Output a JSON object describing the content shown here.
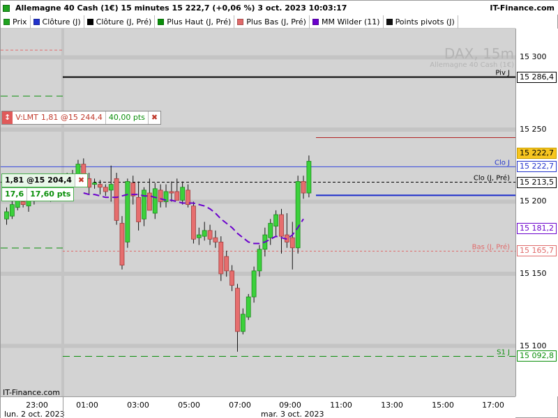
{
  "header": {
    "title": "Allemagne 40 Cash (1€) 15 minutes 15 222,7 (+0,06 %) 3 oct. 2023 10:03:17",
    "brand": "IT-Finance.com",
    "title_color": "#1fa31f"
  },
  "legend": [
    {
      "label": "Prix",
      "color": "#1fa31f"
    },
    {
      "label": "Clôture (J)",
      "color": "#2233cc"
    },
    {
      "label": "Clôture (J, Pré)",
      "color": "#000000"
    },
    {
      "label": "Plus Haut (J, Pré)",
      "color": "#0a8f0a"
    },
    {
      "label": "Plus Bas (J, Pré)",
      "color": "#e06a6a"
    },
    {
      "label": "MM Wilder (11)",
      "color": "#6a00cc"
    },
    {
      "label": "Points pivots (J)",
      "color": "#111111"
    }
  ],
  "watermark": {
    "main": "DAX, 15m",
    "sub": "Allemagne 40 Cash (1€)"
  },
  "credit": "IT-Finance.com",
  "position_tag": {
    "label": "V:LMT",
    "detail": "1,81 @15 244,4",
    "points": "40,00 pts",
    "close": "✖"
  },
  "order_tag": {
    "detail": "1,81 @15 204,4",
    "close": "✖",
    "qty": "17,6",
    "points": "17,60 pts"
  },
  "levels": {
    "piv": {
      "label": "Piv J",
      "value": 15286.4,
      "tag": "15 286,4",
      "color": "#000000"
    },
    "clo_j": {
      "label": "Clo J",
      "value": 15222.7,
      "tag": "15 222,7",
      "color": "#2233cc"
    },
    "clo_pre": {
      "label": "Clo (J, Pré)",
      "value": 15213.5,
      "tag": "15 213,5",
      "color": "#000000"
    },
    "bas_pre": {
      "label": "Bas (J, Pré)",
      "value": 15165.7,
      "tag": "15 165,7",
      "color": "#e06a6a"
    },
    "s1": {
      "label": "S1 J",
      "value": 15092.8,
      "tag": "15 092,8",
      "color": "#0a8f0a"
    },
    "mm": {
      "tag": "15 181,2",
      "value": 15181.2,
      "color": "#6a00cc"
    },
    "last": {
      "tag": "15 222,7",
      "value": 15222.7,
      "color": "#f5c400"
    }
  },
  "chart_data": {
    "type": "candlestick",
    "ylim": [
      15065,
      15320
    ],
    "y_ticks": [
      {
        "value": 15300,
        "label": "15 300"
      },
      {
        "value": 15250,
        "label": "15 250"
      },
      {
        "value": 15200,
        "label": "15 200"
      },
      {
        "value": 15150,
        "label": "15 150"
      },
      {
        "value": 15100,
        "label": "15 100"
      }
    ],
    "x_ticks": [
      "23:00",
      "01:00",
      "03:00",
      "05:00",
      "07:00",
      "09:00",
      "11:00",
      "13:00",
      "15:00",
      "17:00"
    ],
    "dates": [
      "lun. 2 oct. 2023",
      "mar. 3 oct. 2023"
    ],
    "candles": [
      {
        "o": 15188,
        "h": 15196,
        "l": 15184,
        "c": 15193
      },
      {
        "o": 15190,
        "h": 15203,
        "l": 15188,
        "c": 15198
      },
      {
        "o": 15196,
        "h": 15206,
        "l": 15194,
        "c": 15203
      },
      {
        "o": 15200,
        "h": 15206,
        "l": 15196,
        "c": 15198
      },
      {
        "o": 15197,
        "h": 15205,
        "l": 15193,
        "c": 15201
      },
      {
        "o": 15201,
        "h": 15209,
        "l": 15198,
        "c": 15205
      },
      {
        "o": 15205,
        "h": 15212,
        "l": 15201,
        "c": 15207
      },
      {
        "o": 15207,
        "h": 15210,
        "l": 15201,
        "c": 15204
      },
      {
        "o": 15203,
        "h": 15209,
        "l": 15200,
        "c": 15207
      },
      {
        "o": 15207,
        "h": 15214,
        "l": 15205,
        "c": 15212
      },
      {
        "o": 15212,
        "h": 15218,
        "l": 15208,
        "c": 15215
      },
      {
        "o": 15215,
        "h": 15220,
        "l": 15210,
        "c": 15213
      },
      {
        "o": 15213,
        "h": 15222,
        "l": 15210,
        "c": 15218
      },
      {
        "o": 15218,
        "h": 15229,
        "l": 15215,
        "c": 15226
      },
      {
        "o": 15226,
        "h": 15230,
        "l": 15214,
        "c": 15218
      },
      {
        "o": 15216,
        "h": 15220,
        "l": 15205,
        "c": 15210
      },
      {
        "o": 15212,
        "h": 15216,
        "l": 15209,
        "c": 15213
      },
      {
        "o": 15212,
        "h": 15215,
        "l": 15205,
        "c": 15210
      },
      {
        "o": 15210,
        "h": 15212,
        "l": 15204,
        "c": 15207
      },
      {
        "o": 15208,
        "h": 15225,
        "l": 15200,
        "c": 15212
      },
      {
        "o": 15216,
        "h": 15220,
        "l": 15184,
        "c": 15187
      },
      {
        "o": 15185,
        "h": 15190,
        "l": 15153,
        "c": 15156
      },
      {
        "o": 15172,
        "h": 15216,
        "l": 15168,
        "c": 15214
      },
      {
        "o": 15213,
        "h": 15218,
        "l": 15198,
        "c": 15204
      },
      {
        "o": 15203,
        "h": 15214,
        "l": 15180,
        "c": 15186
      },
      {
        "o": 15188,
        "h": 15210,
        "l": 15183,
        "c": 15208
      },
      {
        "o": 15206,
        "h": 15216,
        "l": 15200,
        "c": 15194
      },
      {
        "o": 15192,
        "h": 15213,
        "l": 15188,
        "c": 15209
      },
      {
        "o": 15208,
        "h": 15212,
        "l": 15196,
        "c": 15200
      },
      {
        "o": 15200,
        "h": 15212,
        "l": 15196,
        "c": 15207
      },
      {
        "o": 15207,
        "h": 15214,
        "l": 15200,
        "c": 15206
      },
      {
        "o": 15207,
        "h": 15216,
        "l": 15203,
        "c": 15201
      },
      {
        "o": 15201,
        "h": 15214,
        "l": 15198,
        "c": 15210
      },
      {
        "o": 15208,
        "h": 15212,
        "l": 15196,
        "c": 15198
      },
      {
        "o": 15197,
        "h": 15200,
        "l": 15171,
        "c": 15174
      },
      {
        "o": 15175,
        "h": 15182,
        "l": 15170,
        "c": 15177
      },
      {
        "o": 15176,
        "h": 15186,
        "l": 15173,
        "c": 15180
      },
      {
        "o": 15180,
        "h": 15184,
        "l": 15170,
        "c": 15174
      },
      {
        "o": 15175,
        "h": 15180,
        "l": 15168,
        "c": 15172
      },
      {
        "o": 15172,
        "h": 15176,
        "l": 15145,
        "c": 15150
      },
      {
        "o": 15162,
        "h": 15166,
        "l": 15148,
        "c": 15152
      },
      {
        "o": 15152,
        "h": 15156,
        "l": 15138,
        "c": 15142
      },
      {
        "o": 15140,
        "h": 15143,
        "l": 15096,
        "c": 15110
      },
      {
        "o": 15110,
        "h": 15126,
        "l": 15108,
        "c": 15122
      },
      {
        "o": 15120,
        "h": 15136,
        "l": 15118,
        "c": 15134
      },
      {
        "o": 15134,
        "h": 15155,
        "l": 15130,
        "c": 15152
      },
      {
        "o": 15152,
        "h": 15170,
        "l": 15148,
        "c": 15167
      },
      {
        "o": 15167,
        "h": 15182,
        "l": 15162,
        "c": 15177
      },
      {
        "o": 15175,
        "h": 15188,
        "l": 15170,
        "c": 15185
      },
      {
        "o": 15183,
        "h": 15194,
        "l": 15176,
        "c": 15191
      },
      {
        "o": 15191,
        "h": 15195,
        "l": 15164,
        "c": 15176
      },
      {
        "o": 15177,
        "h": 15192,
        "l": 15168,
        "c": 15172
      },
      {
        "o": 15175,
        "h": 15186,
        "l": 15153,
        "c": 15168
      },
      {
        "o": 15168,
        "h": 15218,
        "l": 15164,
        "c": 15214
      },
      {
        "o": 15214,
        "h": 15218,
        "l": 15202,
        "c": 15206
      },
      {
        "o": 15206,
        "h": 15232,
        "l": 15203,
        "c": 15228
      }
    ],
    "mm_wilder": [
      15206,
      15205,
      15205,
      15204,
      15203,
      15203,
      15203,
      15204,
      15205,
      15205,
      15205,
      15204,
      15204,
      15203,
      15202,
      15201,
      15201,
      15200,
      15199,
      15199,
      15199,
      15198,
      15197,
      15195,
      15192,
      15188,
      15185,
      15182,
      15178,
      15175,
      15172,
      15171,
      15171,
      15172,
      15174,
      15176,
      15175,
      15174,
      15177,
      15182,
      15188
    ]
  }
}
